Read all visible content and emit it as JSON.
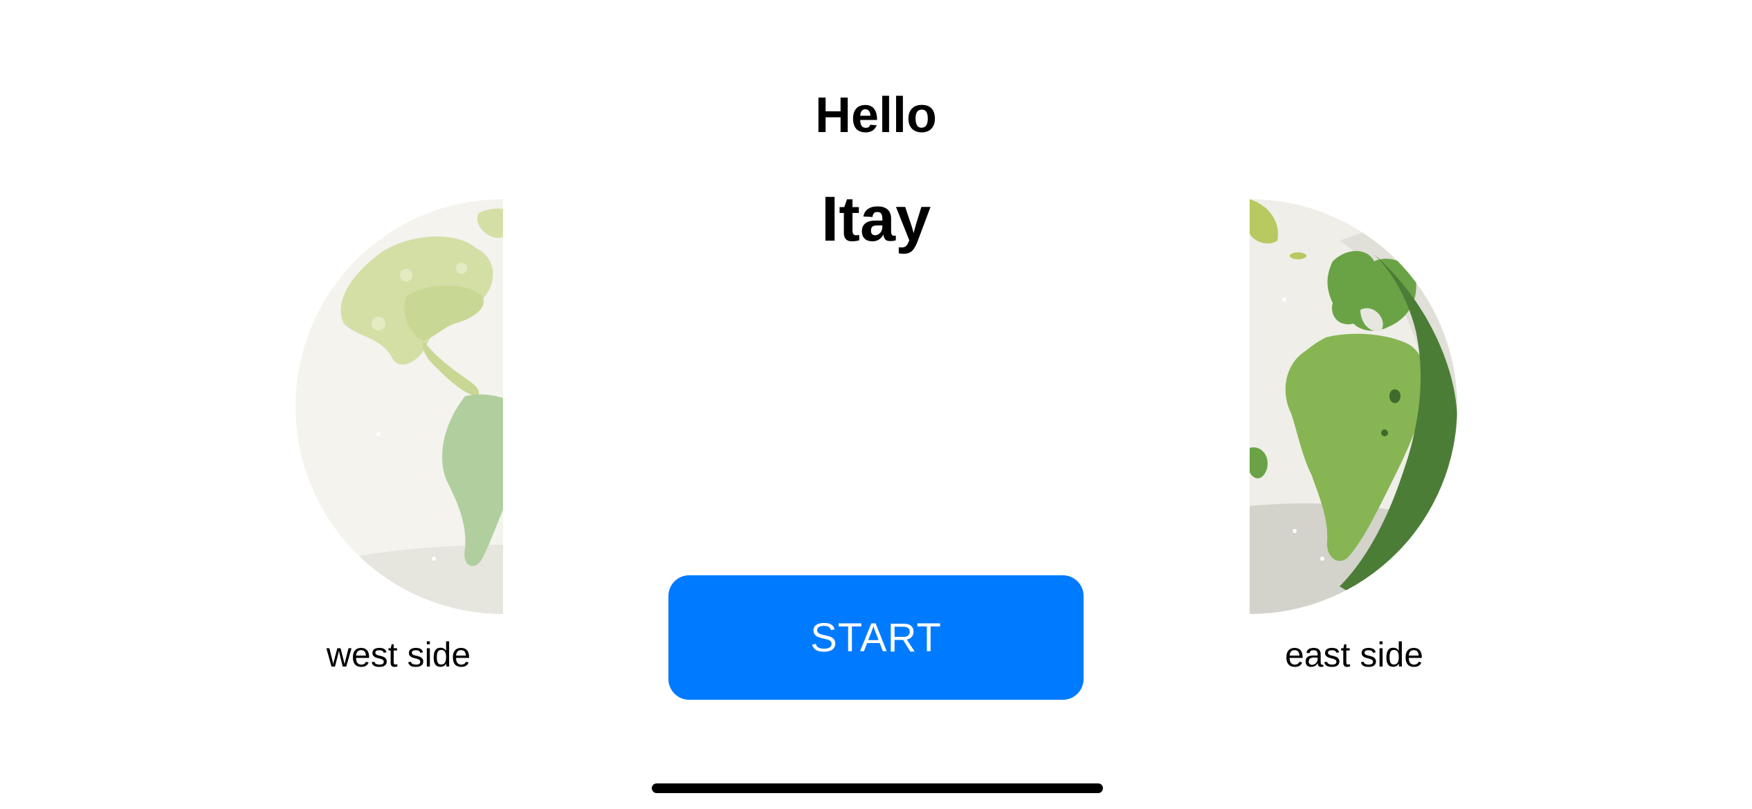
{
  "greeting": "Hello",
  "username": "Itay",
  "globes": {
    "west": {
      "label": "west side",
      "icon": "globe-americas-icon"
    },
    "east": {
      "label": "east side",
      "icon": "globe-europe-africa-icon"
    }
  },
  "start_button": {
    "label": "START",
    "color": "#007aff"
  }
}
